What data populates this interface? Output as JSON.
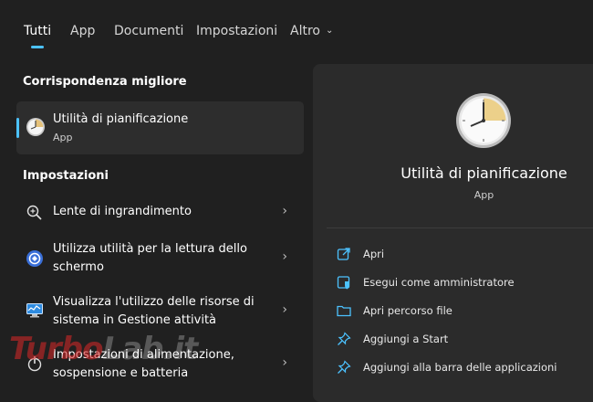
{
  "tabs": [
    {
      "label": "Tutti"
    },
    {
      "label": "App"
    },
    {
      "label": "Documenti"
    },
    {
      "label": "Impostazioni"
    },
    {
      "label": "Altro"
    }
  ],
  "best_match": {
    "section_title": "Corrispondenza migliore",
    "name": "Utilità di pianificazione",
    "type": "App"
  },
  "settings": {
    "section_title": "Impostazioni",
    "items": [
      {
        "label_line1": "Lente di ingrandimento",
        "label_line2": "",
        "icon": "magnifier-icon"
      },
      {
        "label_line1": "Utilizza utilità per la lettura dello",
        "label_line2": "schermo",
        "icon": "narrator-icon"
      },
      {
        "label_line1": "Visualizza l'utilizzo delle risorse di",
        "label_line2": "sistema in Gestione attività",
        "icon": "monitor-icon"
      },
      {
        "label_line1": "Impostazioni di alimentazione,",
        "label_line2": "sospensione e batteria",
        "icon": "power-icon"
      }
    ]
  },
  "detail": {
    "title": "Utilità di pianificazione",
    "subtitle": "App",
    "actions": [
      {
        "label": "Apri",
        "icon": "open-icon"
      },
      {
        "label": "Esegui come amministratore",
        "icon": "shield-icon"
      },
      {
        "label": "Apri percorso file",
        "icon": "folder-icon"
      },
      {
        "label": "Aggiungi a Start",
        "icon": "pin-icon"
      },
      {
        "label": "Aggiungi alla barra delle applicazioni",
        "icon": "pin-icon"
      }
    ]
  },
  "watermark": {
    "part1": "Turbo",
    "part2": "Lab.it"
  },
  "colors": {
    "accent": "#4cc2ff",
    "background": "#202020",
    "panel": "#2b2b2b"
  }
}
